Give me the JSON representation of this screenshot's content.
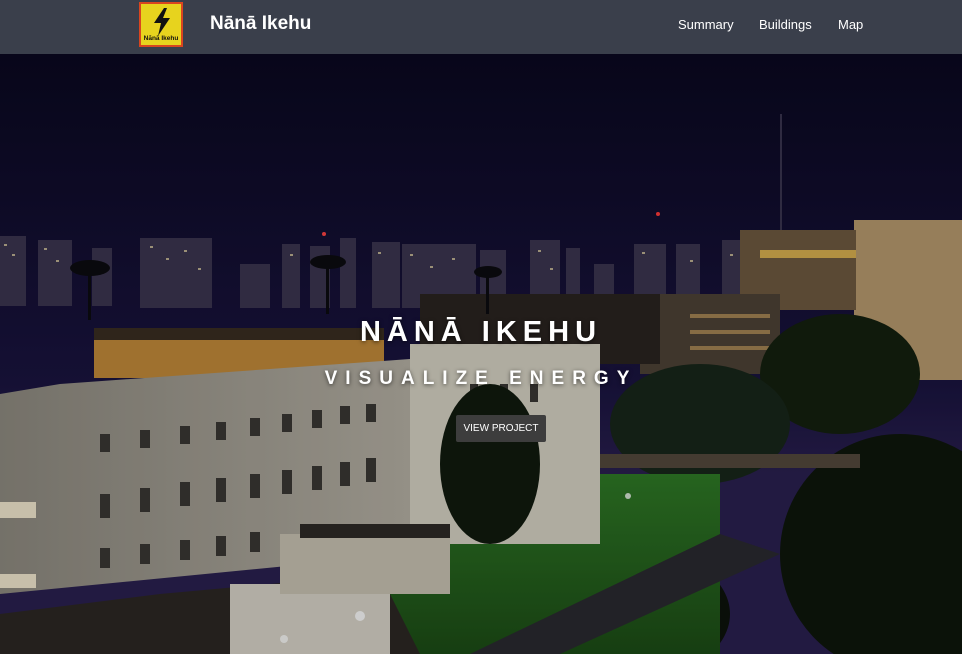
{
  "header": {
    "logo_text": "Nānā Ikehu",
    "brand": "Nānā Ikehu",
    "nav": [
      "Summary",
      "Buildings",
      "Map"
    ]
  },
  "hero": {
    "title": "NĀNĀ IKEHU",
    "subtitle": "VISUALIZE ENERGY",
    "button_label": "VIEW PROJECT"
  },
  "colors": {
    "navbar": "#3a3f4b",
    "logo_bg": "#e7d31e",
    "logo_border": "#d9451f",
    "button_bg": "#3d3d3d"
  },
  "icons": {
    "logo": "lightning-bolt-icon"
  }
}
